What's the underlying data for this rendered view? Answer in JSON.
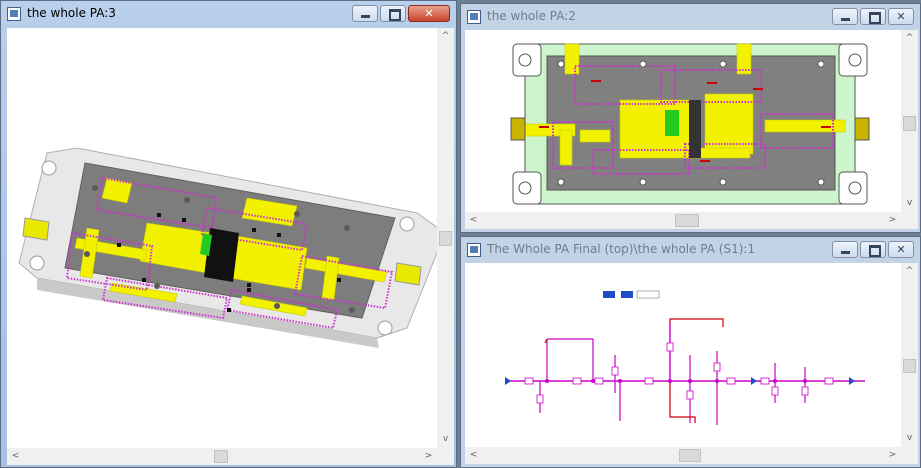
{
  "windows": {
    "w3": {
      "title": "the whole PA:3"
    },
    "w2": {
      "title": "the whole PA:2"
    },
    "w1": {
      "title": "The Whole PA Final (top)\\the whole PA (S1):1"
    }
  },
  "scroll": {
    "up": "^",
    "down": "v",
    "left": "<",
    "right": ">"
  },
  "colors": {
    "pcb_yellow": "#f2f200",
    "via_magenta": "#cc33cc",
    "board_gray": "#808080",
    "housing_green": "#ccf5cc",
    "wire_magenta": "#cc00cc",
    "wire_red": "#cc0000",
    "desktop": "#6e7f93"
  }
}
